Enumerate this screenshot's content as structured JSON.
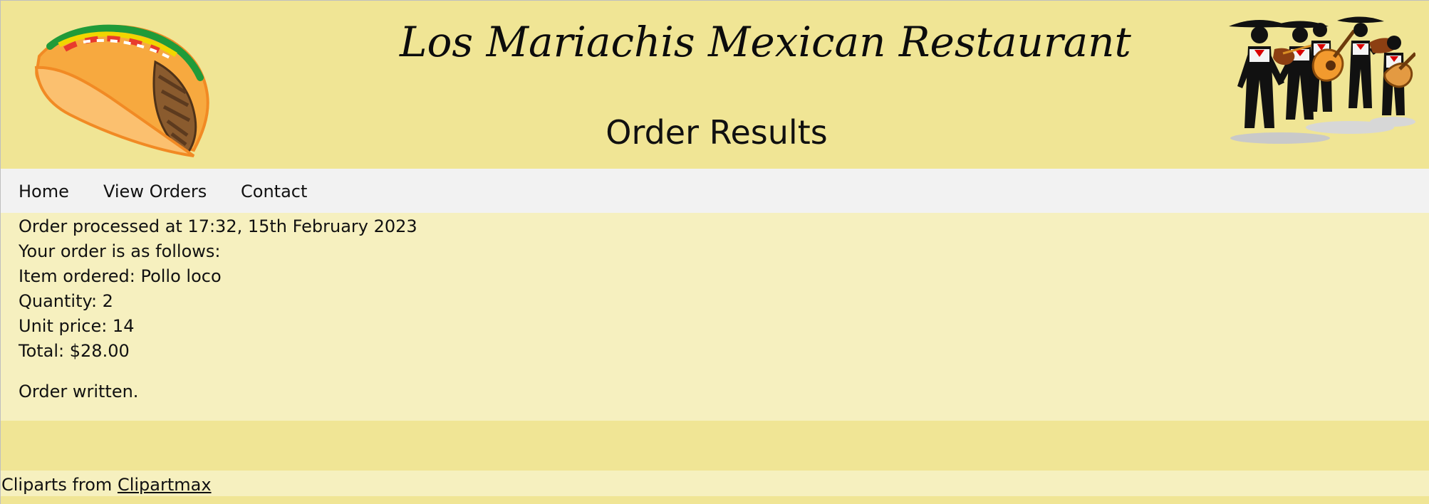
{
  "header": {
    "site_title": "Los Mariachis Mexican Restaurant",
    "page_title": "Order Results",
    "left_image": "taco-icon",
    "right_image": "mariachi-band-icon"
  },
  "nav": {
    "items": [
      {
        "label": "Home"
      },
      {
        "label": "View Orders"
      },
      {
        "label": "Contact"
      }
    ]
  },
  "order": {
    "processed": "Order processed at 17:32, 15th February 2023",
    "intro": "Your order is as follows:",
    "item": "Item ordered: Pollo loco",
    "quantity": "Quantity: 2",
    "unit_price": "Unit price: 14",
    "total": "Total: $28.00",
    "status": "Order written."
  },
  "footer": {
    "prefix": "Cliparts from ",
    "link_text": "Clipartmax"
  },
  "colors": {
    "header_bg": "#f0e595",
    "content_bg": "#f6f0bf",
    "nav_bg": "#f2f2f2"
  }
}
